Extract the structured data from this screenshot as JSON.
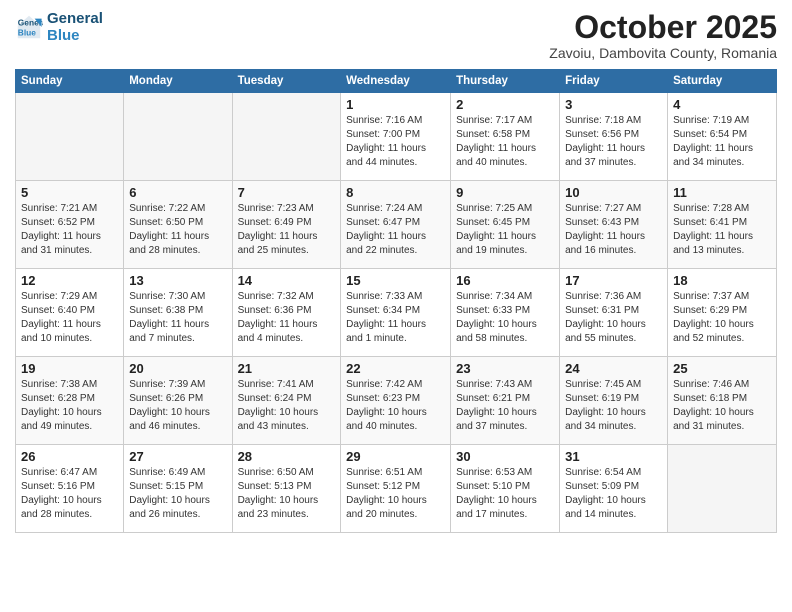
{
  "header": {
    "logo_line1": "General",
    "logo_line2": "Blue",
    "month": "October 2025",
    "location": "Zavoiu, Dambovita County, Romania"
  },
  "weekdays": [
    "Sunday",
    "Monday",
    "Tuesday",
    "Wednesday",
    "Thursday",
    "Friday",
    "Saturday"
  ],
  "weeks": [
    [
      {
        "day": "",
        "info": ""
      },
      {
        "day": "",
        "info": ""
      },
      {
        "day": "",
        "info": ""
      },
      {
        "day": "1",
        "info": "Sunrise: 7:16 AM\nSunset: 7:00 PM\nDaylight: 11 hours and 44 minutes."
      },
      {
        "day": "2",
        "info": "Sunrise: 7:17 AM\nSunset: 6:58 PM\nDaylight: 11 hours and 40 minutes."
      },
      {
        "day": "3",
        "info": "Sunrise: 7:18 AM\nSunset: 6:56 PM\nDaylight: 11 hours and 37 minutes."
      },
      {
        "day": "4",
        "info": "Sunrise: 7:19 AM\nSunset: 6:54 PM\nDaylight: 11 hours and 34 minutes."
      }
    ],
    [
      {
        "day": "5",
        "info": "Sunrise: 7:21 AM\nSunset: 6:52 PM\nDaylight: 11 hours and 31 minutes."
      },
      {
        "day": "6",
        "info": "Sunrise: 7:22 AM\nSunset: 6:50 PM\nDaylight: 11 hours and 28 minutes."
      },
      {
        "day": "7",
        "info": "Sunrise: 7:23 AM\nSunset: 6:49 PM\nDaylight: 11 hours and 25 minutes."
      },
      {
        "day": "8",
        "info": "Sunrise: 7:24 AM\nSunset: 6:47 PM\nDaylight: 11 hours and 22 minutes."
      },
      {
        "day": "9",
        "info": "Sunrise: 7:25 AM\nSunset: 6:45 PM\nDaylight: 11 hours and 19 minutes."
      },
      {
        "day": "10",
        "info": "Sunrise: 7:27 AM\nSunset: 6:43 PM\nDaylight: 11 hours and 16 minutes."
      },
      {
        "day": "11",
        "info": "Sunrise: 7:28 AM\nSunset: 6:41 PM\nDaylight: 11 hours and 13 minutes."
      }
    ],
    [
      {
        "day": "12",
        "info": "Sunrise: 7:29 AM\nSunset: 6:40 PM\nDaylight: 11 hours and 10 minutes."
      },
      {
        "day": "13",
        "info": "Sunrise: 7:30 AM\nSunset: 6:38 PM\nDaylight: 11 hours and 7 minutes."
      },
      {
        "day": "14",
        "info": "Sunrise: 7:32 AM\nSunset: 6:36 PM\nDaylight: 11 hours and 4 minutes."
      },
      {
        "day": "15",
        "info": "Sunrise: 7:33 AM\nSunset: 6:34 PM\nDaylight: 11 hours and 1 minute."
      },
      {
        "day": "16",
        "info": "Sunrise: 7:34 AM\nSunset: 6:33 PM\nDaylight: 10 hours and 58 minutes."
      },
      {
        "day": "17",
        "info": "Sunrise: 7:36 AM\nSunset: 6:31 PM\nDaylight: 10 hours and 55 minutes."
      },
      {
        "day": "18",
        "info": "Sunrise: 7:37 AM\nSunset: 6:29 PM\nDaylight: 10 hours and 52 minutes."
      }
    ],
    [
      {
        "day": "19",
        "info": "Sunrise: 7:38 AM\nSunset: 6:28 PM\nDaylight: 10 hours and 49 minutes."
      },
      {
        "day": "20",
        "info": "Sunrise: 7:39 AM\nSunset: 6:26 PM\nDaylight: 10 hours and 46 minutes."
      },
      {
        "day": "21",
        "info": "Sunrise: 7:41 AM\nSunset: 6:24 PM\nDaylight: 10 hours and 43 minutes."
      },
      {
        "day": "22",
        "info": "Sunrise: 7:42 AM\nSunset: 6:23 PM\nDaylight: 10 hours and 40 minutes."
      },
      {
        "day": "23",
        "info": "Sunrise: 7:43 AM\nSunset: 6:21 PM\nDaylight: 10 hours and 37 minutes."
      },
      {
        "day": "24",
        "info": "Sunrise: 7:45 AM\nSunset: 6:19 PM\nDaylight: 10 hours and 34 minutes."
      },
      {
        "day": "25",
        "info": "Sunrise: 7:46 AM\nSunset: 6:18 PM\nDaylight: 10 hours and 31 minutes."
      }
    ],
    [
      {
        "day": "26",
        "info": "Sunrise: 6:47 AM\nSunset: 5:16 PM\nDaylight: 10 hours and 28 minutes."
      },
      {
        "day": "27",
        "info": "Sunrise: 6:49 AM\nSunset: 5:15 PM\nDaylight: 10 hours and 26 minutes."
      },
      {
        "day": "28",
        "info": "Sunrise: 6:50 AM\nSunset: 5:13 PM\nDaylight: 10 hours and 23 minutes."
      },
      {
        "day": "29",
        "info": "Sunrise: 6:51 AM\nSunset: 5:12 PM\nDaylight: 10 hours and 20 minutes."
      },
      {
        "day": "30",
        "info": "Sunrise: 6:53 AM\nSunset: 5:10 PM\nDaylight: 10 hours and 17 minutes."
      },
      {
        "day": "31",
        "info": "Sunrise: 6:54 AM\nSunset: 5:09 PM\nDaylight: 10 hours and 14 minutes."
      },
      {
        "day": "",
        "info": ""
      }
    ]
  ]
}
